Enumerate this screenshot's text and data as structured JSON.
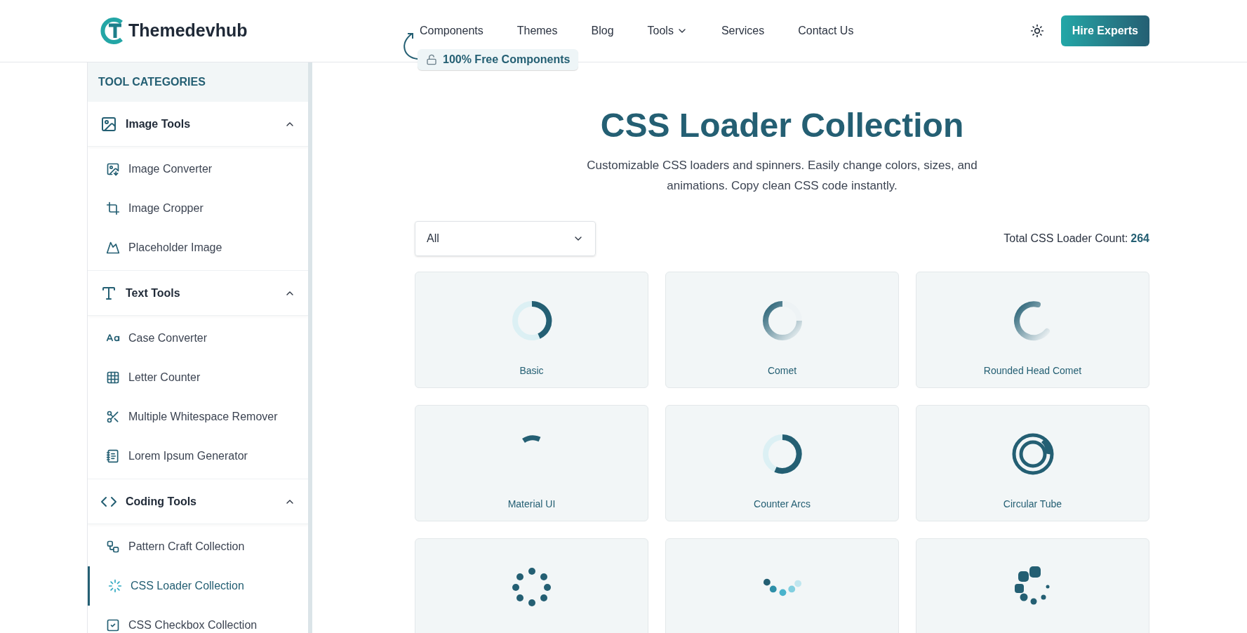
{
  "brand": {
    "name": "Themedevhub"
  },
  "nav": [
    {
      "label": "Components",
      "dropdown": false
    },
    {
      "label": "Themes",
      "dropdown": false
    },
    {
      "label": "Blog",
      "dropdown": false
    },
    {
      "label": "Tools",
      "dropdown": true
    },
    {
      "label": "Services",
      "dropdown": false
    },
    {
      "label": "Contact Us",
      "dropdown": false
    }
  ],
  "promo_badge": "100% Free Components",
  "cta": "Hire Experts",
  "sidebar": {
    "title": "TOOL CATEGORIES",
    "categories": [
      {
        "label": "Image Tools",
        "expanded": true,
        "items": [
          {
            "label": "Image Converter",
            "selected": false
          },
          {
            "label": "Image Cropper",
            "selected": false
          },
          {
            "label": "Placeholder Image",
            "selected": false
          }
        ]
      },
      {
        "label": "Text Tools",
        "expanded": true,
        "items": [
          {
            "label": "Case Converter",
            "selected": false
          },
          {
            "label": "Letter Counter",
            "selected": false
          },
          {
            "label": "Multiple Whitespace Remover",
            "selected": false
          },
          {
            "label": "Lorem Ipsum Generator",
            "selected": false
          }
        ]
      },
      {
        "label": "Coding Tools",
        "expanded": true,
        "items": [
          {
            "label": "Pattern Craft Collection",
            "selected": false
          },
          {
            "label": "CSS Loader Collection",
            "selected": true
          },
          {
            "label": "CSS Checkbox Collection",
            "selected": false
          }
        ]
      }
    ]
  },
  "page": {
    "title": "CSS Loader Collection",
    "subtitle": "Customizable CSS loaders and spinners. Easily change colors, sizes, and animations. Copy clean CSS code instantly.",
    "filter": {
      "value": "All"
    },
    "count_label": "Total CSS Loader Count:",
    "count": "264"
  },
  "loaders": [
    {
      "kind": "ring",
      "label": "Basic"
    },
    {
      "kind": "comet",
      "label": "Comet"
    },
    {
      "kind": "rounded-comet",
      "label": "Rounded Head Comet"
    },
    {
      "kind": "arc",
      "label": "Material UI"
    },
    {
      "kind": "counter-arcs",
      "label": "Counter Arcs"
    },
    {
      "kind": "tube",
      "label": "Circular Tube"
    },
    {
      "kind": "dot-ring"
    },
    {
      "kind": "wave-dots"
    },
    {
      "kind": "scaling-dots"
    }
  ]
}
